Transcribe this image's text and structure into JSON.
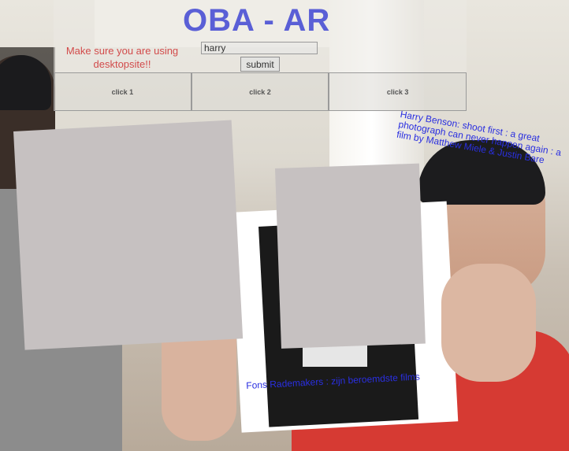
{
  "header": {
    "title": "OBA - AR",
    "hint": "Make sure you are using desktopsite!!"
  },
  "search": {
    "value": "harry",
    "submit_label": "submit"
  },
  "tabs": [
    {
      "label": "click 1"
    },
    {
      "label": "click 2"
    },
    {
      "label": "click 3"
    }
  ],
  "ar": {
    "labels": [
      "Harry Benson: shoot first : a great photograph can never happen again : a film by Matthew Miele & Justin Bare",
      "Fons Rademakers : zijn beroemdste films"
    ]
  }
}
